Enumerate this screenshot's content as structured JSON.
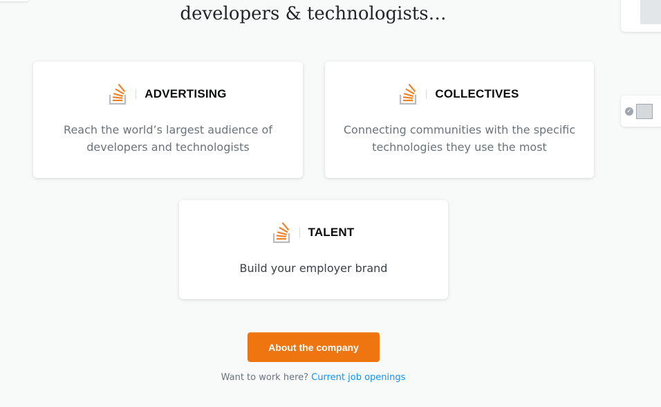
{
  "headline": {
    "line2": "developers & technologists…"
  },
  "cards": [
    {
      "title": "ADVERTISING",
      "description": "Reach the world’s largest audience of developers and technologists"
    },
    {
      "title": "COLLECTIVES",
      "description": "Connecting communities with the specific technologies they use the most"
    },
    {
      "title": "TALENT",
      "description": "Build your employer brand"
    }
  ],
  "cta": {
    "label": "About the company"
  },
  "jobs": {
    "prefix": "Want to work here?",
    "link": "Current job openings"
  },
  "colors": {
    "accent": "#ee7510",
    "link": "#0a95ff",
    "background": "#f8f9f9"
  },
  "icons": {
    "logo": "stack-overflow-logo-icon",
    "check": "check-circle-icon",
    "avatar": "user-avatar-icon"
  }
}
